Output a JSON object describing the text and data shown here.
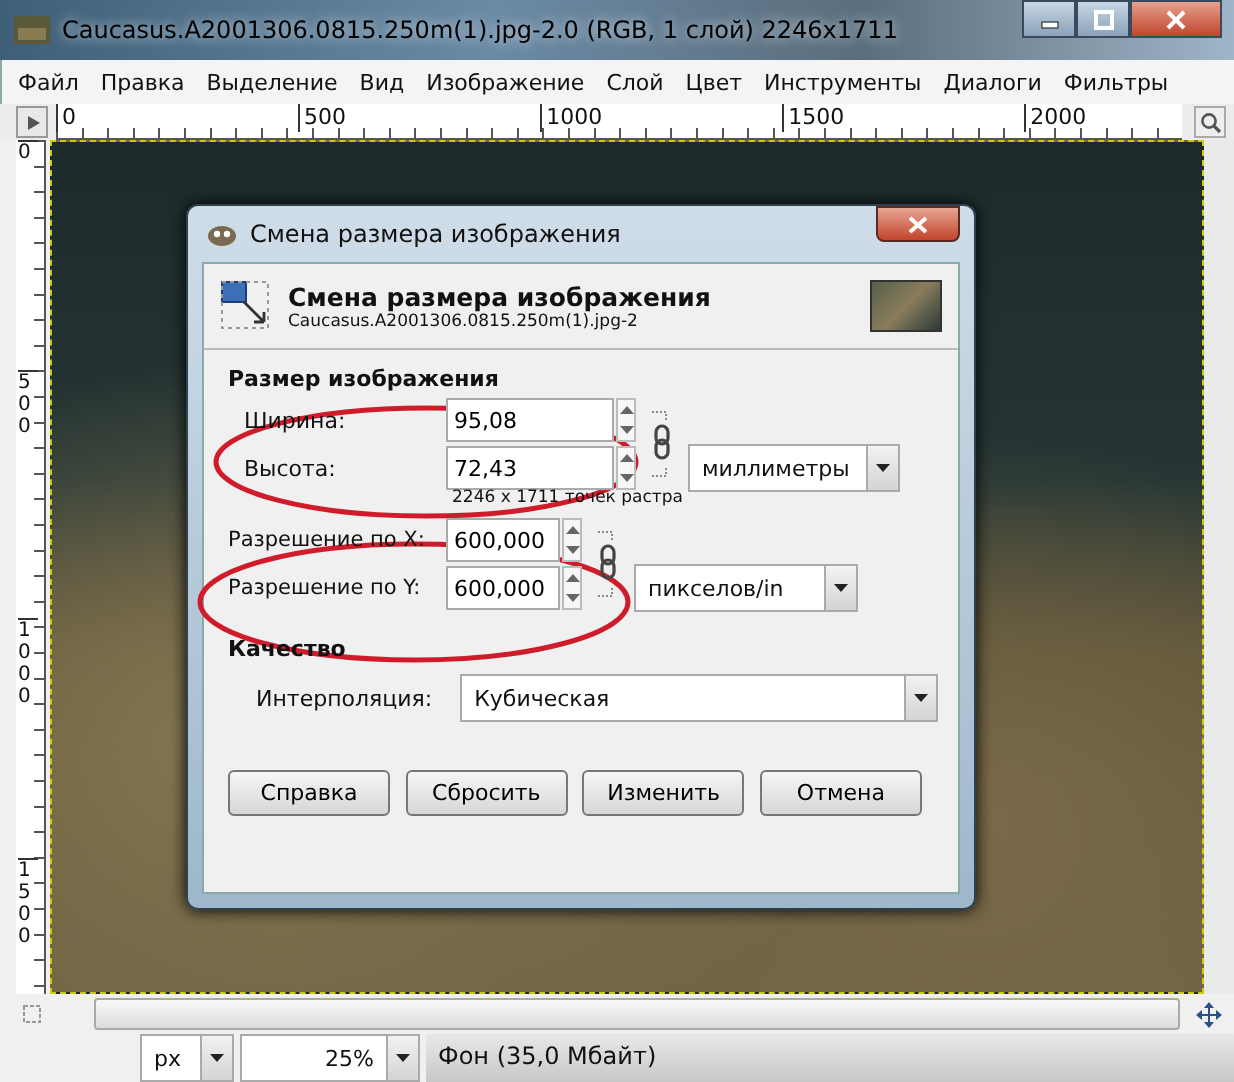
{
  "window": {
    "title": "Caucasus.A2001306.0815.250m(1).jpg-2.0 (RGB, 1 слой) 2246x1711"
  },
  "menu": [
    "Файл",
    "Правка",
    "Выделение",
    "Вид",
    "Изображение",
    "Слой",
    "Цвет",
    "Инструменты",
    "Диалоги",
    "Фильтры"
  ],
  "rulers": {
    "horizontal": [
      "0",
      "500",
      "1000",
      "1500",
      "2000"
    ],
    "vertical": [
      "0",
      "500",
      "1000",
      "1500"
    ]
  },
  "dialog": {
    "title": "Смена размера изображения",
    "heading": "Смена размера изображения",
    "subtitle": "Caucasus.A2001306.0815.250m(1).jpg-2",
    "size_section": {
      "title": "Размер изображения",
      "fields": [
        {
          "label": "Ширина:",
          "value": "95,08"
        },
        {
          "label": "Высота:",
          "value": "72,43"
        }
      ],
      "unit": "миллиметры",
      "note": "2246 x 1711 точек растра",
      "linked": true
    },
    "resolution_section": {
      "fields": [
        {
          "label": "Разрешение по X:",
          "value": "600,000"
        },
        {
          "label": "Разрешение по Y:",
          "value": "600,000"
        }
      ],
      "unit": "пикселов/in",
      "linked": true
    },
    "quality_section": {
      "title": "Качество",
      "label": "Интерполяция:",
      "value": "Кубическая"
    },
    "buttons": [
      "Справка",
      "Сбросить",
      "Изменить",
      "Отмена"
    ]
  },
  "annotations": [
    {
      "color": "#d01c2a"
    },
    {
      "color": "#d01c2a"
    }
  ],
  "status_bar": {
    "unit": "px",
    "zoom": "25%",
    "layer_info": "Фон (35,0 Мбайт)"
  }
}
